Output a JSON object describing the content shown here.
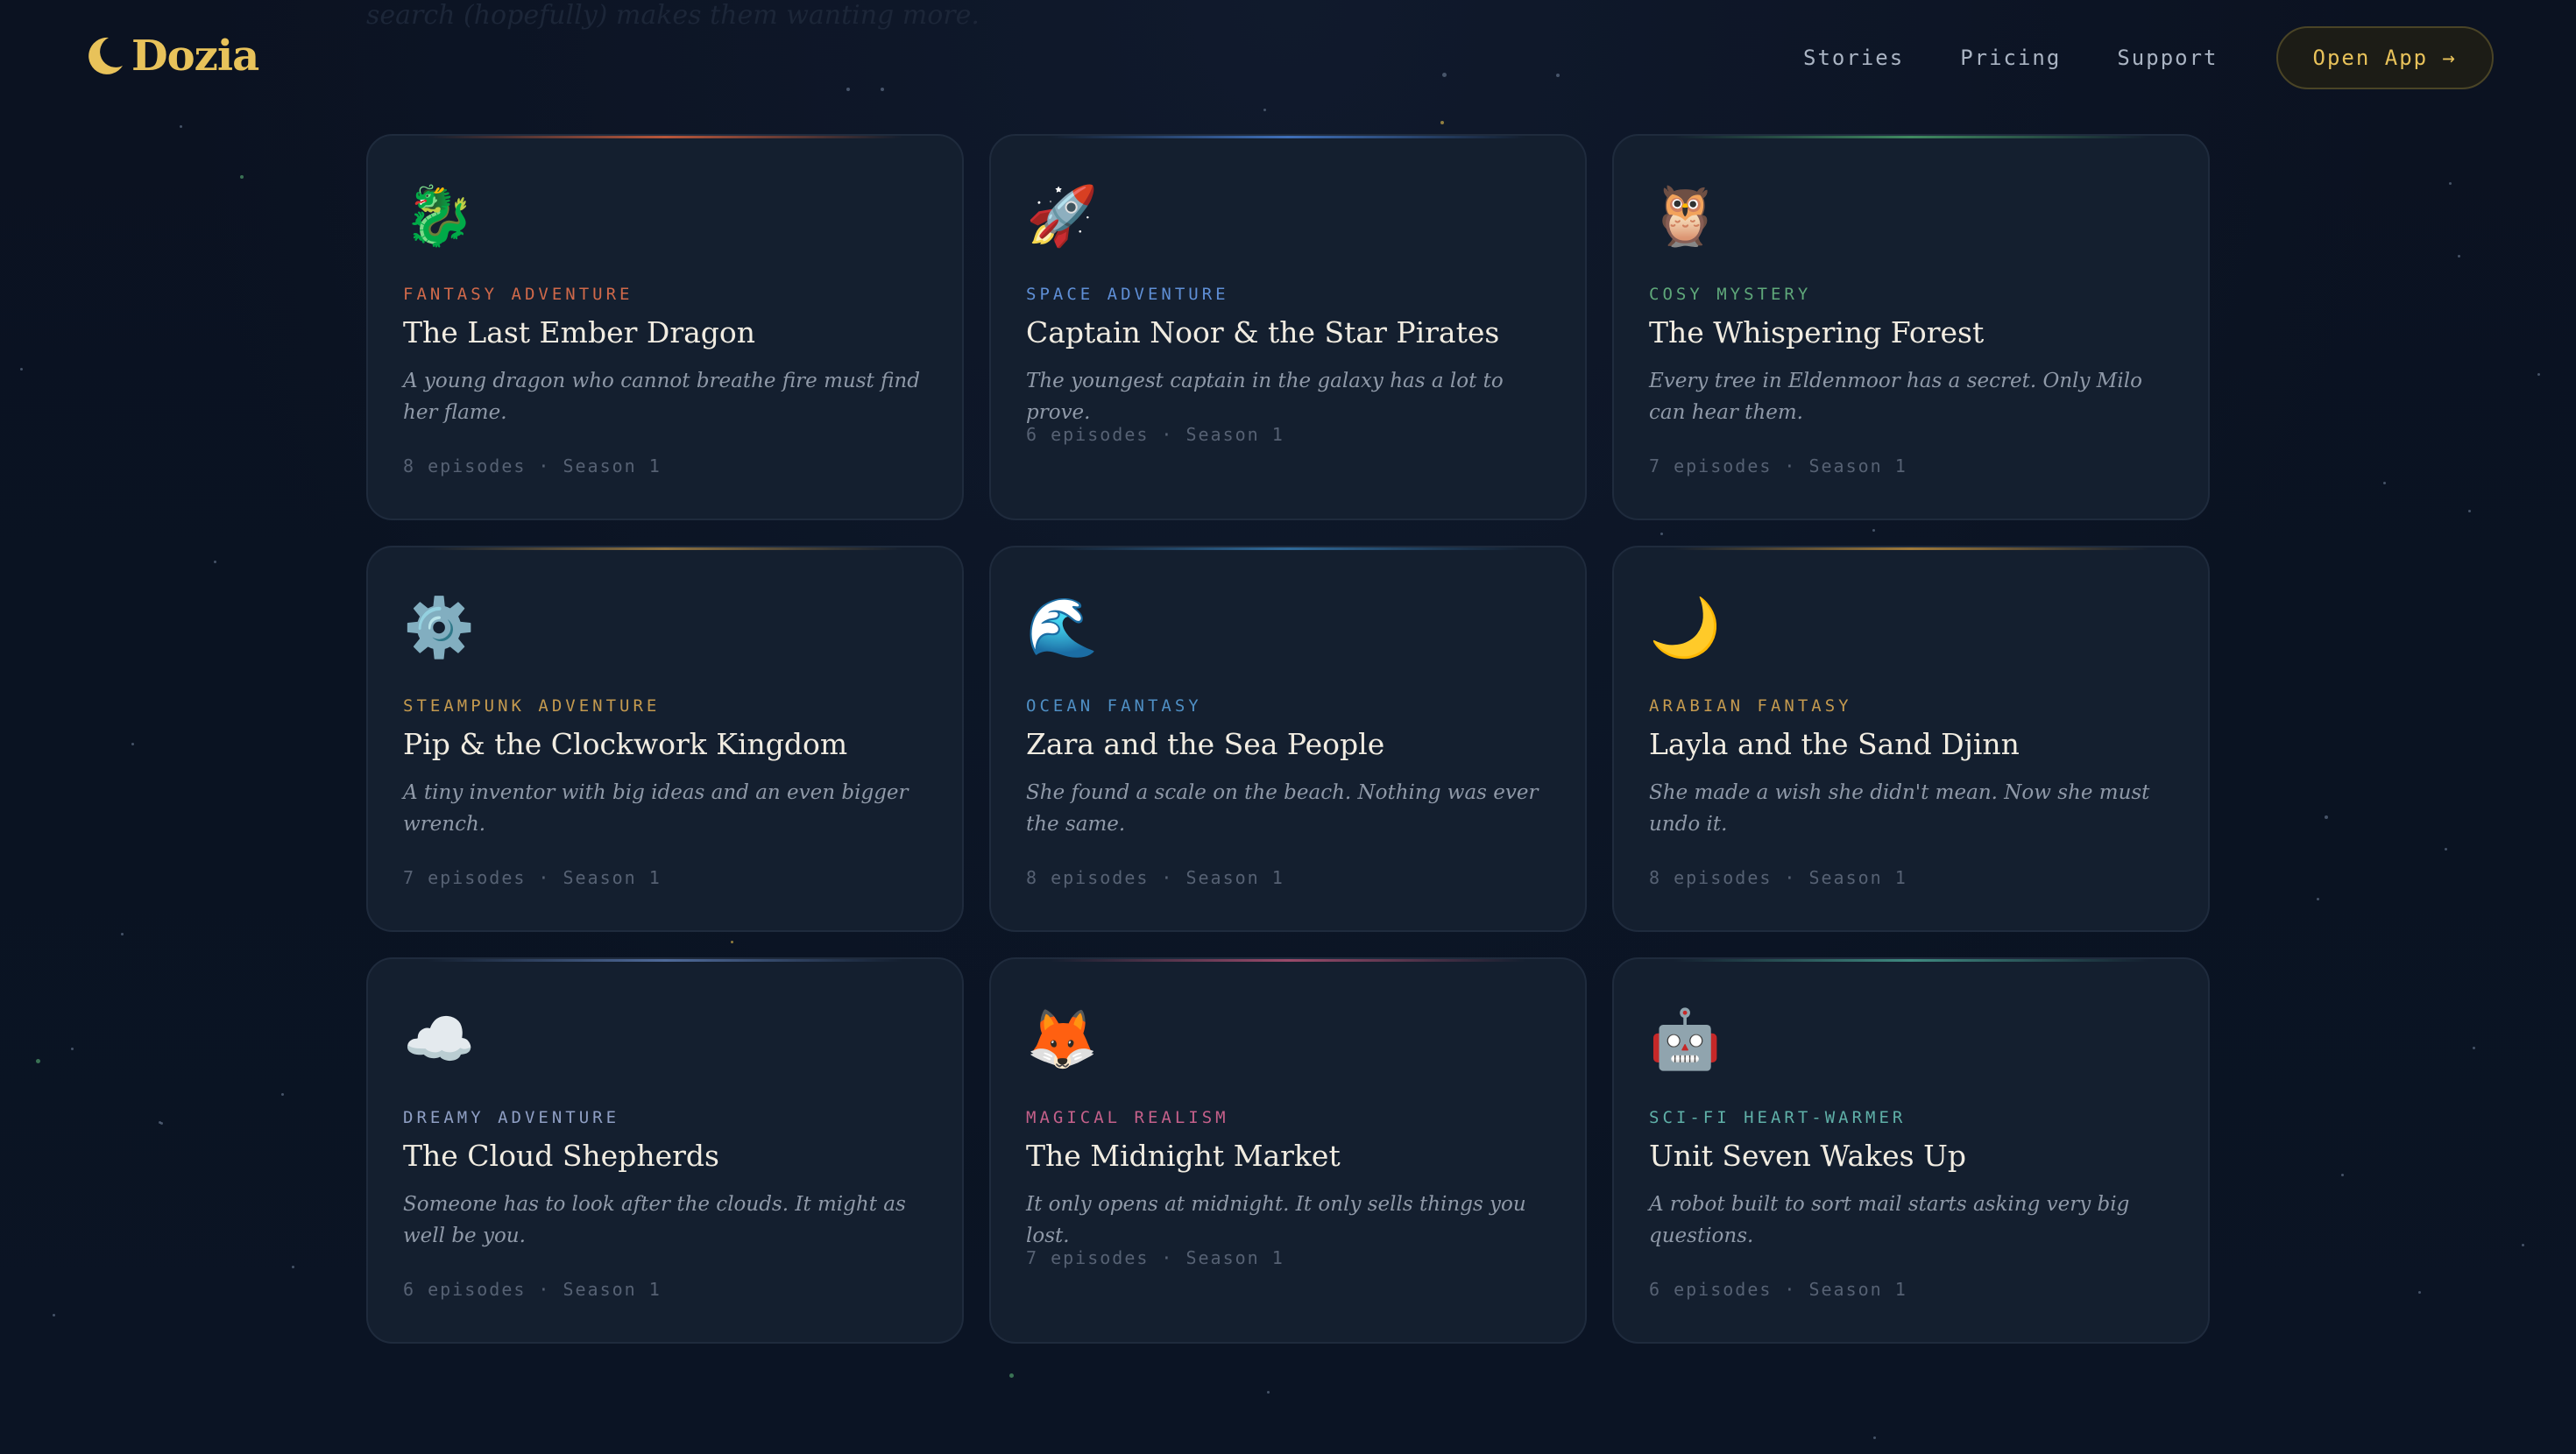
{
  "background_text": "search (hopefully) makes them wanting more.",
  "header": {
    "logo_text": "Dozia",
    "nav": [
      {
        "label": "Stories"
      },
      {
        "label": "Pricing"
      },
      {
        "label": "Support"
      }
    ],
    "cta_label": "Open App →"
  },
  "colors": {
    "accent_gold": "#e8c25a",
    "card_bg": "#141f2f",
    "title": "#f1ece1"
  },
  "stories": [
    {
      "emoji": "🐉",
      "icon": "dragon-icon",
      "genre": "FANTASY ADVENTURE",
      "genre_color": "#d0694a",
      "accent": "#b8563a",
      "title": "The Last Ember Dragon",
      "desc": "A young dragon who cannot breathe fire must find her flame.",
      "episodes": "8 episodes",
      "dot": "·",
      "season": "Season 1",
      "lines": 2
    },
    {
      "emoji": "🚀",
      "icon": "rocket-icon",
      "genre": "SPACE ADVENTURE",
      "genre_color": "#5f8fd6",
      "accent": "#3f6fb8",
      "title": "Captain Noor & the Star Pirates",
      "desc": "The youngest captain in the galaxy has a lot to prove.",
      "episodes": "6 episodes",
      "dot": "·",
      "season": "Season 1",
      "lines": 1
    },
    {
      "emoji": "🦉",
      "icon": "owl-icon",
      "genre": "COSY MYSTERY",
      "genre_color": "#5fa87a",
      "accent": "#3f8a60",
      "title": "The Whispering Forest",
      "desc": "Every tree in Eldenmoor has a secret. Only Milo can hear them.",
      "episodes": "7 episodes",
      "dot": "·",
      "season": "Season 1",
      "lines": 2
    },
    {
      "emoji": "⚙️",
      "icon": "gear-icon",
      "genre": "STEAMPUNK ADVENTURE",
      "genre_color": "#c49a4f",
      "accent": "#8f7240",
      "title": "Pip & the Clockwork Kingdom",
      "desc": "A tiny inventor with big ideas and an even bigger wrench.",
      "episodes": "7 episodes",
      "dot": "·",
      "season": "Season 1",
      "lines": 2
    },
    {
      "emoji": "🌊",
      "icon": "wave-icon",
      "genre": "OCEAN FANTASY",
      "genre_color": "#4f8fc4",
      "accent": "#2f6a9a",
      "title": "Zara and the Sea People",
      "desc": "She found a scale on the beach. Nothing was ever the same.",
      "episodes": "8 episodes",
      "dot": "·",
      "season": "Season 1",
      "lines": 2
    },
    {
      "emoji": "🌙",
      "icon": "crescent-moon-icon",
      "genre": "ARABIAN FANTASY",
      "genre_color": "#c49a4f",
      "accent": "#a07a3a",
      "title": "Layla and the Sand Djinn",
      "desc": "She made a wish she didn't mean. Now she must undo it.",
      "episodes": "8 episodes",
      "dot": "·",
      "season": "Season 1",
      "lines": 2
    },
    {
      "emoji": "☁️",
      "icon": "cloud-icon",
      "genre": "DREAMY ADVENTURE",
      "genre_color": "#8f9fc4",
      "accent": "#4f6a9a",
      "title": "The Cloud Shepherds",
      "desc": "Someone has to look after the clouds. It might as well be you.",
      "episodes": "6 episodes",
      "dot": "·",
      "season": "Season 1",
      "lines": 2
    },
    {
      "emoji": "🦊",
      "icon": "fox-icon",
      "genre": "MAGICAL REALISM",
      "genre_color": "#c4608a",
      "accent": "#9a4a6a",
      "title": "The Midnight Market",
      "desc": "It only opens at midnight. It only sells things you lost.",
      "episodes": "7 episodes",
      "dot": "·",
      "season": "Season 1",
      "lines": 1
    },
    {
      "emoji": "🤖",
      "icon": "robot-icon",
      "genre": "SCI-FI HEART-WARMER",
      "genre_color": "#5fb0a8",
      "accent": "#3f8a80",
      "title": "Unit Seven Wakes Up",
      "desc": "A robot built to sort mail starts asking very big questions.",
      "episodes": "6 episodes",
      "dot": "·",
      "season": "Season 1",
      "lines": 2
    }
  ]
}
